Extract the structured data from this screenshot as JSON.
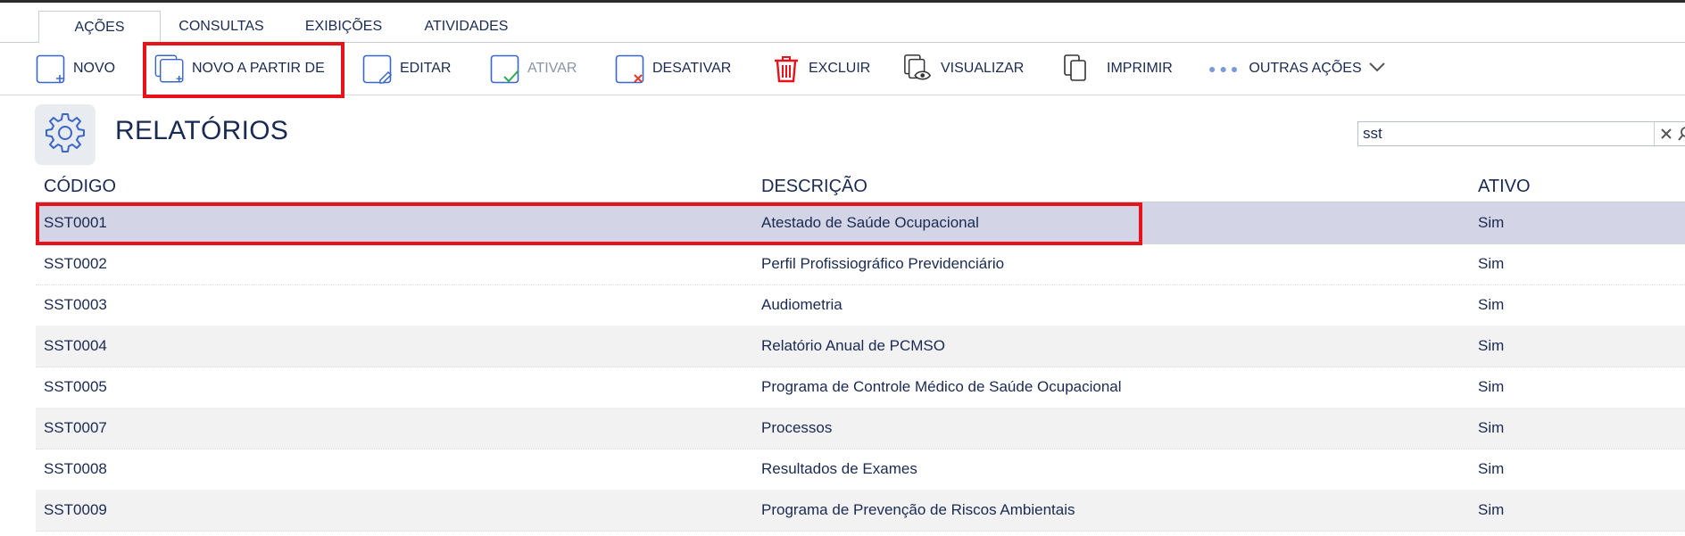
{
  "tabs": [
    "AÇÕES",
    "CONSULTAS",
    "EXIBIÇÕES",
    "ATIVIDADES"
  ],
  "toolbar": {
    "novo": "NOVO",
    "novo_partir": "NOVO A PARTIR DE",
    "editar": "EDITAR",
    "ativar": "ATIVAR",
    "desativar": "DESATIVAR",
    "excluir": "EXCLUIR",
    "visualizar": "VISUALIZAR",
    "imprimir": "IMPRIMIR",
    "outras": "OUTRAS AÇÕES"
  },
  "page": {
    "title": "RELATÓRIOS"
  },
  "search": {
    "value": "sst"
  },
  "table": {
    "columns": [
      "CÓDIGO",
      "DESCRIÇÃO",
      "ATIVO"
    ],
    "rows": [
      {
        "codigo": "SST0001",
        "descricao": "Atestado de Saúde Ocupacional",
        "ativo": "Sim"
      },
      {
        "codigo": "SST0002",
        "descricao": "Perfil Profissiográfico Previdenciário",
        "ativo": "Sim"
      },
      {
        "codigo": "SST0003",
        "descricao": "Audiometria",
        "ativo": "Sim"
      },
      {
        "codigo": "SST0004",
        "descricao": "Relatório Anual de PCMSO",
        "ativo": "Sim"
      },
      {
        "codigo": "SST0005",
        "descricao": "Programa de Controle Médico de Saúde Ocupacional",
        "ativo": "Sim"
      },
      {
        "codigo": "SST0007",
        "descricao": "Processos",
        "ativo": "Sim"
      },
      {
        "codigo": "SST0008",
        "descricao": "Resultados de Exames",
        "ativo": "Sim"
      },
      {
        "codigo": "SST0009",
        "descricao": "Programa de Prevenção de Riscos Ambientais",
        "ativo": "Sim"
      }
    ]
  },
  "colors": {
    "accent": "#3a66c8",
    "highlight": "#e8131a",
    "selected_row": "#d3d5e6",
    "text": "#1a2a52"
  }
}
